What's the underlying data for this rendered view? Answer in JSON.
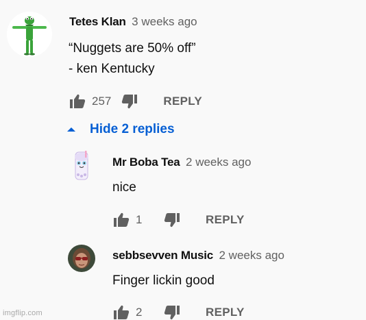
{
  "comments": {
    "top": {
      "author": "Tetes Klan",
      "time": "3 weeks ago",
      "lines": [
        "“Nuggets are 50% off”",
        "- ken Kentucky"
      ],
      "likes": "257",
      "reply_label": "REPLY",
      "avatar_icon": "kermit-avatar",
      "accent_color": "#3aa33a"
    },
    "toggle_label": "Hide 2 replies",
    "replies": [
      {
        "author": "Mr Boba Tea",
        "time": "2 weeks ago",
        "text": "nice",
        "likes": "1",
        "reply_label": "REPLY",
        "avatar_icon": "boba-tea-avatar"
      },
      {
        "author": "sebbsevven Music",
        "time": "2 weeks ago",
        "text": "Finger lickin good",
        "likes": "2",
        "reply_label": "REPLY",
        "avatar_icon": "person-sunglasses-avatar"
      }
    ]
  },
  "watermark": "imgflip.com",
  "colors": {
    "background": "#f9f9f9",
    "link_blue": "#065fd4",
    "secondary_text": "#606060"
  }
}
